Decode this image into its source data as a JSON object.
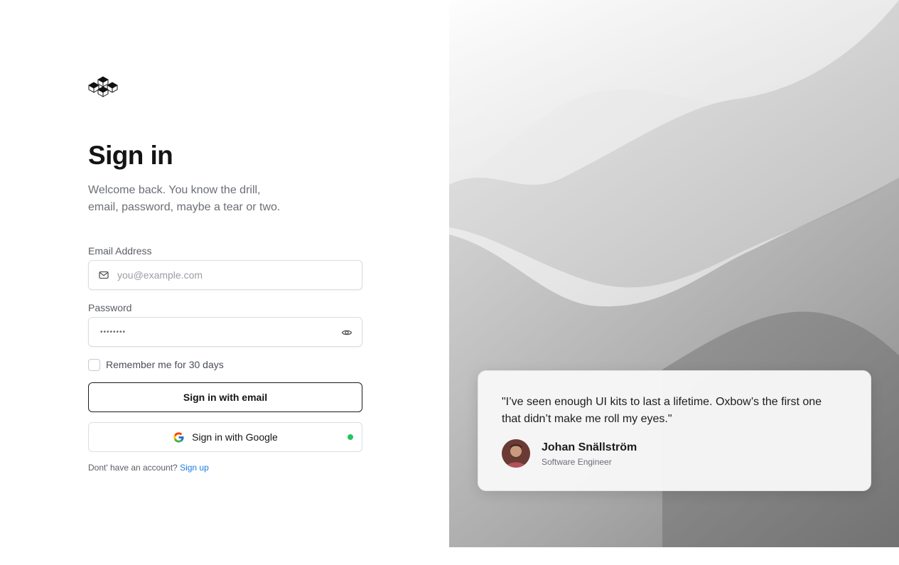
{
  "header": {
    "logo_icon": "oxbow-cubes-logo",
    "title": "Sign in",
    "subtitle_line1": "Welcome back. You know the drill,",
    "subtitle_line2": "email, password, maybe a tear or two."
  },
  "form": {
    "email": {
      "label": "Email Address",
      "placeholder": "you@example.com",
      "value": "",
      "icon": "mail-icon"
    },
    "password": {
      "label": "Password",
      "value": "••••••••",
      "icon": "eye-icon"
    },
    "remember": {
      "label": "Remember me for 30 days",
      "checked": false
    },
    "email_button_label": "Sign in with email",
    "google_button_label": "Sign in with Google",
    "google_status_color": "#22c55e"
  },
  "footer": {
    "prompt": "Dont' have an account?",
    "link_label": "Sign up",
    "link_color": "#1e7be0"
  },
  "testimonial": {
    "quote_line1": "\"I’ve seen enough UI kits to last a lifetime. Oxbow’s the first one",
    "quote_line2": "that didn’t make me roll my eyes.\"",
    "name": "Johan Snällström",
    "role": "Software Engineer"
  }
}
